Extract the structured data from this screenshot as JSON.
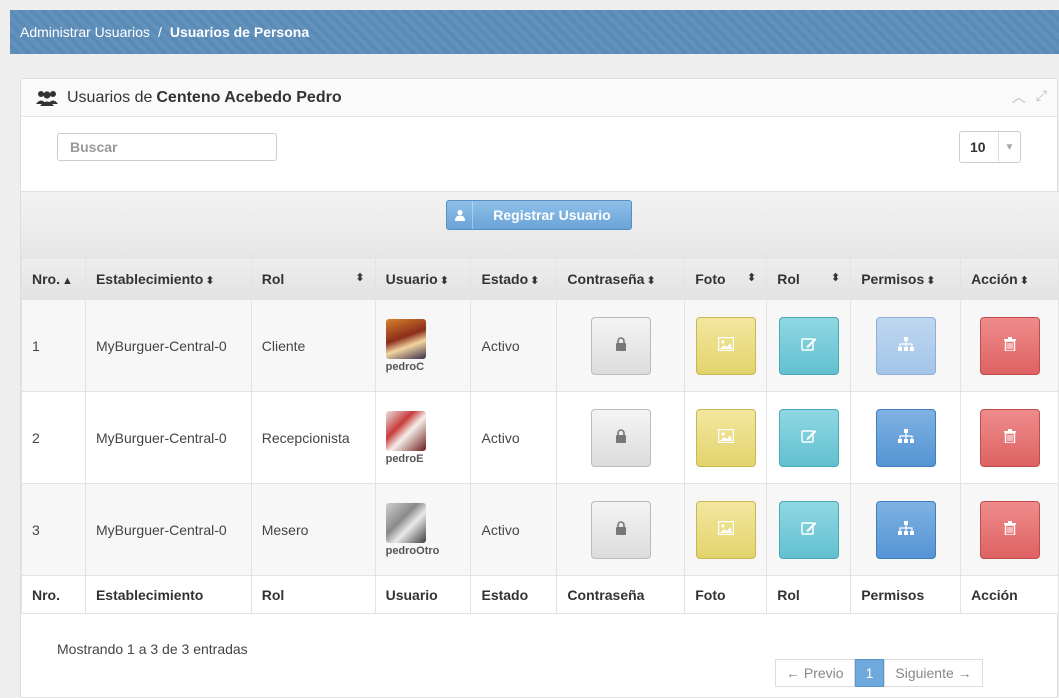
{
  "breadcrumb": {
    "parent": "Administrar Usuarios",
    "separator": "/",
    "current": "Usuarios de Persona"
  },
  "panel": {
    "title_prefix": "Usuarios de",
    "title_name": "Centeno Acebedo Pedro"
  },
  "search": {
    "placeholder": "Buscar",
    "value": ""
  },
  "page_size": {
    "selected": "10"
  },
  "register_button": {
    "label": "Registrar Usuario"
  },
  "table": {
    "headers": [
      "Nro.",
      "Establecimiento",
      "Rol",
      "Usuario",
      "Estado",
      "Contraseña",
      "Foto",
      "Rol",
      "Permisos",
      "Acción"
    ],
    "rows": [
      {
        "nro": "1",
        "establecimiento": "MyBurguer-Central-0",
        "rol": "Cliente",
        "usuario": "pedroC",
        "estado": "Activo"
      },
      {
        "nro": "2",
        "establecimiento": "MyBurguer-Central-0",
        "rol": "Recepcionista",
        "usuario": "pedroE",
        "estado": "Activo"
      },
      {
        "nro": "3",
        "establecimiento": "MyBurguer-Central-0",
        "rol": "Mesero",
        "usuario": "pedroOtro",
        "estado": "Activo"
      }
    ]
  },
  "footer": {
    "info": "Mostrando 1 a 3 de 3 entradas",
    "prev": "← Previo",
    "page": "1",
    "next": "Siguiente →"
  },
  "colors": {
    "topbar": "#5c8dba",
    "primary": "#6aa4d8",
    "danger": "#de6262",
    "warning": "#e3d36d",
    "info": "#62c0cf"
  }
}
